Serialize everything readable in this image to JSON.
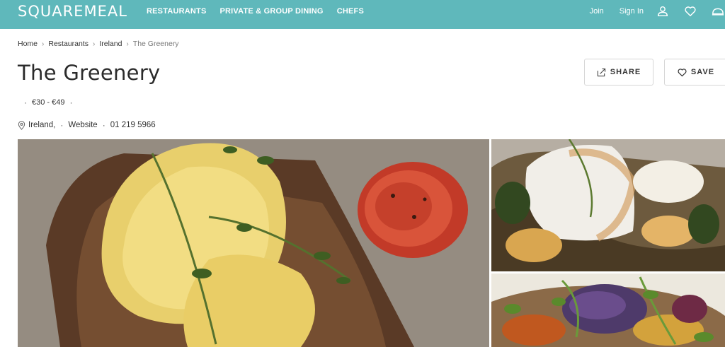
{
  "header": {
    "brand": "SQUAREMEAL",
    "nav": [
      "RESTAURANTS",
      "PRIVATE & GROUP DINING",
      "CHEFS"
    ],
    "join": "Join",
    "sign_in": "Sign In",
    "icons": [
      "user-icon",
      "heart-icon",
      "cloche-icon"
    ],
    "bg_color": "#5fb8bb",
    "accent_color": "#e8466f"
  },
  "breadcrumb": [
    "Home",
    "Restaurants",
    "Ireland",
    "The Greenery"
  ],
  "restaurant": {
    "name": "The Greenery",
    "price_range": "€30 - €49",
    "location": "Ireland,",
    "website": "Website",
    "phone": "01 219 5966"
  },
  "actions": {
    "share": "SHARE",
    "save": "SAVE"
  },
  "gallery": {
    "images": [
      "eggs-benedict-photo",
      "fish-dish-photo",
      "salad-photo"
    ]
  }
}
